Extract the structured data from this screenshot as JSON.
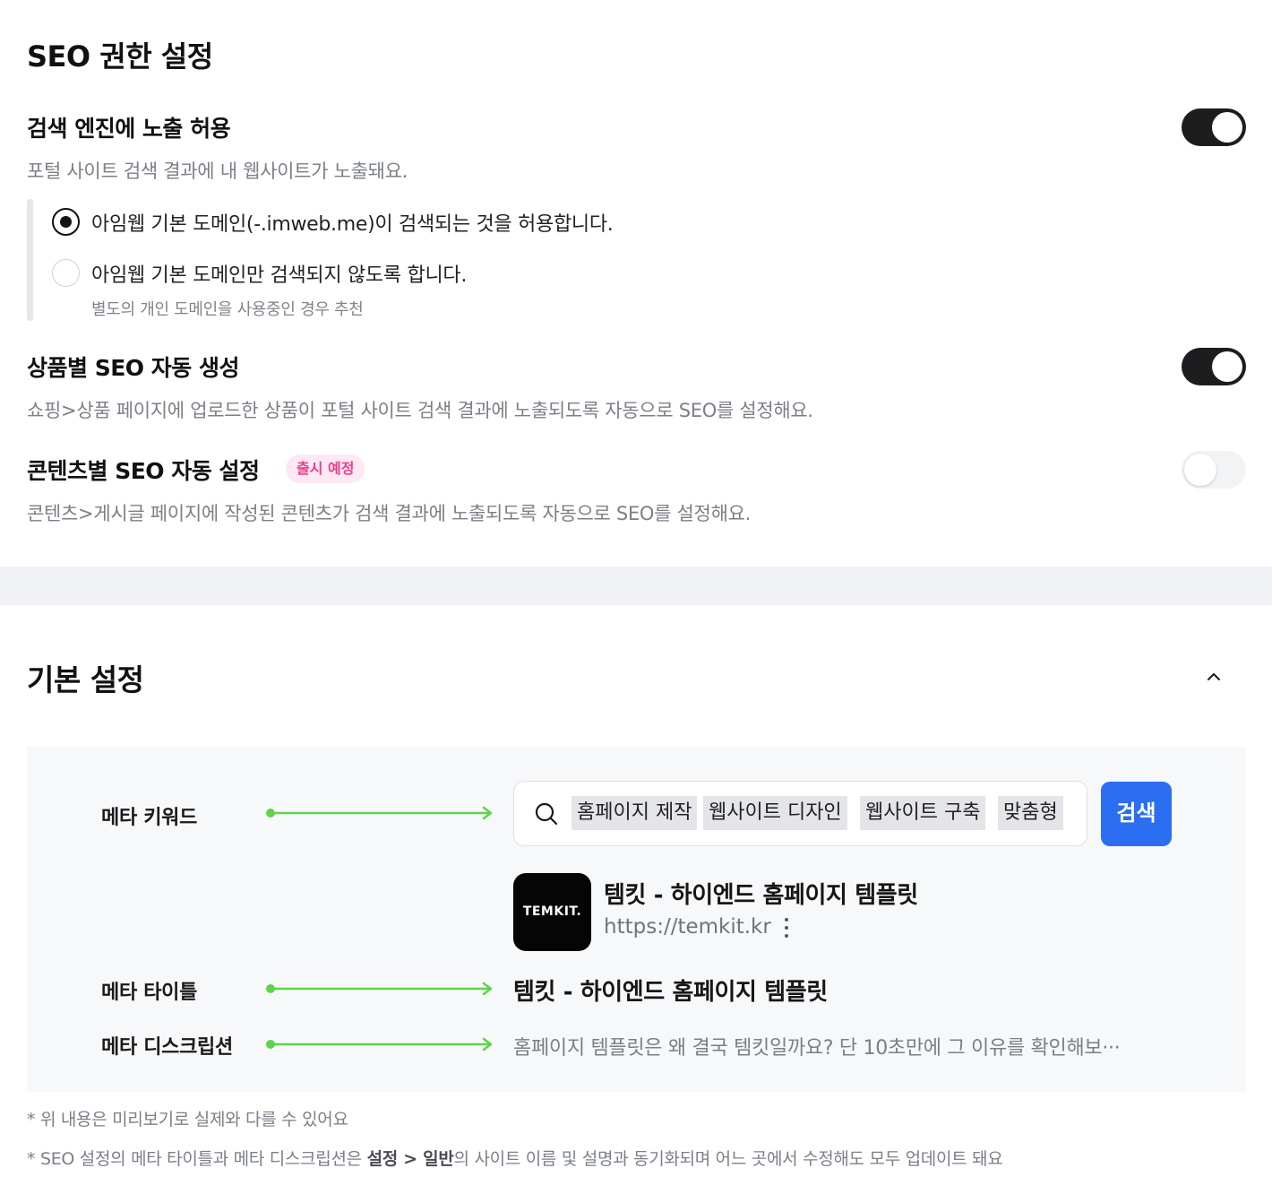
{
  "seo_section": {
    "title": "SEO 권한 설정",
    "search_exposure": {
      "title": "검색 엔진에 노출 허용",
      "description": "포털 사이트 검색 결과에 내 웹사이트가 노출돼요.",
      "enabled": true,
      "options": [
        {
          "label": "아임웹 기본 도메인(-.imweb.me)이 검색되는 것을 허용합니다.",
          "selected": true,
          "sub": ""
        },
        {
          "label": "아임웹 기본 도메인만 검색되지 않도록 합니다.",
          "selected": false,
          "sub": "별도의 개인 도메인을 사용중인 경우 추천"
        }
      ]
    },
    "product_seo": {
      "title": "상품별 SEO 자동 생성",
      "description": "쇼핑>상품 페이지에 업로드한 상품이 포털 사이트 검색 결과에 노출되도록 자동으로 SEO를 설정해요.",
      "enabled": true
    },
    "content_seo": {
      "title": "콘텐츠별 SEO 자동 설정",
      "badge": "출시 예정",
      "description": "콘텐츠>게시글 페이지에 작성된 콘텐츠가 검색 결과에 노출되도록 자동으로 SEO를 설정해요.",
      "enabled": false
    }
  },
  "basic_section": {
    "title": "기본 설정",
    "collapse_icon": "chevron-up-icon",
    "preview": {
      "labels": {
        "keywords": "메타 키워드",
        "title": "메타 타이틀",
        "description": "메타 디스크립션"
      },
      "keyword_chips": [
        "홈페이지 제작",
        "웹사이트 디자인",
        "웹사이트 구축",
        "맞춤형"
      ],
      "search_button": "검색",
      "logo_text": "TEMKIT.",
      "result_title": "템킷 - 하이엔드 홈페이지 템플릿",
      "result_url": "https://temkit.kr",
      "meta_title": "템킷 - 하이엔드 홈페이지 템플릿",
      "meta_description": "홈페이지 템플릿은 왜 결국 템킷일까요? 단 10초만에 그 이유를 확인해보···"
    },
    "notes": {
      "note1": "* 위 내용은 미리보기로 실제와 다를 수 있어요",
      "note2_prefix": "* SEO 설정의 메타 타이틀과 메타 디스크립션은 ",
      "note2_bold": "설정 > 일반",
      "note2_suffix": "의 사이트 이름 및 설명과 동기화되며 어느 곳에서 수정해도 모두 업데이트 돼요"
    }
  },
  "colors": {
    "accent": "#2b6ef2",
    "toggle_on": "#1d1d1f",
    "arrow_green": "#5dd44a",
    "badge_pink": "#e8408e"
  }
}
